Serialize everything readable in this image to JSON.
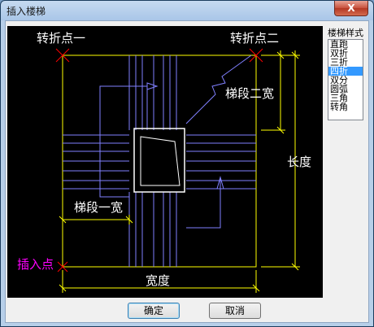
{
  "window": {
    "title": "插入楼梯",
    "close_glyph": "X"
  },
  "drawing": {
    "turn_point_1": "转折点一",
    "turn_point_2": "转折点二",
    "flight_2_width": "梯段二宽",
    "length": "长度",
    "flight_1_width": "梯段一宽",
    "insert_point": "插入点",
    "width": "宽度",
    "colors": {
      "background": "#000000",
      "frame": "#ffff00",
      "stair": "#8080ff",
      "text": "#ffffff",
      "marker": "#ff0000",
      "insert_text": "#ff00ff"
    }
  },
  "style_panel": {
    "label": "楼梯样式",
    "items": [
      "直跑",
      "双折",
      "三折",
      "四折",
      "双分",
      "圆弧",
      "三角",
      "转角"
    ],
    "selected_index": 3
  },
  "buttons": {
    "ok": "确定",
    "cancel": "取消"
  }
}
